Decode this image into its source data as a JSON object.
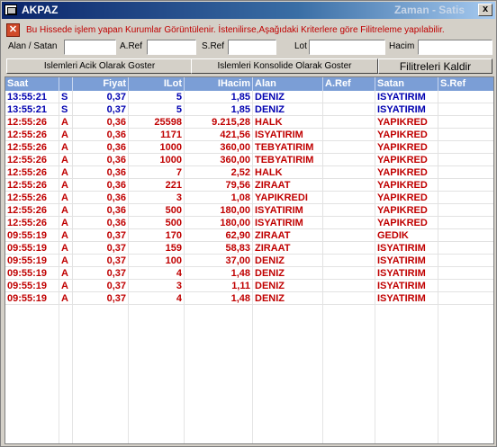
{
  "window": {
    "title": "AKPAZ",
    "title_right": "Zaman - Satis",
    "close_label": "x"
  },
  "info": {
    "text": "Bu Hissede işlem yapan Kurumlar Görüntülenir. İstenilirse,Aşağıdaki Kriterlere göre Filitreleme yapılabilir."
  },
  "filters": {
    "alan_satan_label": "Alan / Satan",
    "aref_label": "A.Ref",
    "sref_label": "S.Ref",
    "lot_label": "Lot",
    "hacim_label": "Hacim",
    "alan_satan_value": "",
    "aref_value": "",
    "sref_value": "",
    "lot_value": "",
    "hacim_value": ""
  },
  "buttons": {
    "acik": "Islemleri Acik Olarak Goster",
    "konsolide": "Islemleri Konsolide Olarak Goster",
    "kaldir": "Filitreleri Kaldir"
  },
  "table": {
    "headers": [
      "Saat",
      "",
      "Fiyat",
      "ILot",
      "IHacim",
      "Alan",
      "A.Ref",
      "Satan",
      "S.Ref"
    ],
    "rows": [
      {
        "saat": "13:55:21",
        "t": "S",
        "fiyat": "0,37",
        "lot": "5",
        "hacim": "1,85",
        "alan": "DENIZ",
        "aref": "",
        "satan": "ISYATIRIM",
        "sref": "",
        "color": "#0000b0"
      },
      {
        "saat": "13:55:21",
        "t": "S",
        "fiyat": "0,37",
        "lot": "5",
        "hacim": "1,85",
        "alan": "DENIZ",
        "aref": "",
        "satan": "ISYATIRIM",
        "sref": "",
        "color": "#0000b0"
      },
      {
        "saat": "12:55:26",
        "t": "A",
        "fiyat": "0,36",
        "lot": "25598",
        "hacim": "9.215,28",
        "alan": "HALK",
        "aref": "",
        "satan": "YAPIKRED",
        "sref": "",
        "color": "#c00000"
      },
      {
        "saat": "12:55:26",
        "t": "A",
        "fiyat": "0,36",
        "lot": "1171",
        "hacim": "421,56",
        "alan": "ISYATIRIM",
        "aref": "",
        "satan": "YAPIKRED",
        "sref": "",
        "color": "#c00000"
      },
      {
        "saat": "12:55:26",
        "t": "A",
        "fiyat": "0,36",
        "lot": "1000",
        "hacim": "360,00",
        "alan": "TEBYATIRIM",
        "aref": "",
        "satan": "YAPIKRED",
        "sref": "",
        "color": "#c00000"
      },
      {
        "saat": "12:55:26",
        "t": "A",
        "fiyat": "0,36",
        "lot": "1000",
        "hacim": "360,00",
        "alan": "TEBYATIRIM",
        "aref": "",
        "satan": "YAPIKRED",
        "sref": "",
        "color": "#c00000"
      },
      {
        "saat": "12:55:26",
        "t": "A",
        "fiyat": "0,36",
        "lot": "7",
        "hacim": "2,52",
        "alan": "HALK",
        "aref": "",
        "satan": "YAPIKRED",
        "sref": "",
        "color": "#c00000"
      },
      {
        "saat": "12:55:26",
        "t": "A",
        "fiyat": "0,36",
        "lot": "221",
        "hacim": "79,56",
        "alan": "ZIRAAT",
        "aref": "",
        "satan": "YAPIKRED",
        "sref": "",
        "color": "#c00000"
      },
      {
        "saat": "12:55:26",
        "t": "A",
        "fiyat": "0,36",
        "lot": "3",
        "hacim": "1,08",
        "alan": "YAPIKREDI",
        "aref": "",
        "satan": "YAPIKRED",
        "sref": "",
        "color": "#c00000"
      },
      {
        "saat": "12:55:26",
        "t": "A",
        "fiyat": "0,36",
        "lot": "500",
        "hacim": "180,00",
        "alan": "ISYATIRIM",
        "aref": "",
        "satan": "YAPIKRED",
        "sref": "",
        "color": "#c00000"
      },
      {
        "saat": "12:55:26",
        "t": "A",
        "fiyat": "0,36",
        "lot": "500",
        "hacim": "180,00",
        "alan": "ISYATIRIM",
        "aref": "",
        "satan": "YAPIKRED",
        "sref": "",
        "color": "#c00000"
      },
      {
        "saat": "09:55:19",
        "t": "A",
        "fiyat": "0,37",
        "lot": "170",
        "hacim": "62,90",
        "alan": "ZIRAAT",
        "aref": "",
        "satan": "GEDIK",
        "sref": "",
        "color": "#c00000"
      },
      {
        "saat": "09:55:19",
        "t": "A",
        "fiyat": "0,37",
        "lot": "159",
        "hacim": "58,83",
        "alan": "ZIRAAT",
        "aref": "",
        "satan": "ISYATIRIM",
        "sref": "",
        "color": "#c00000"
      },
      {
        "saat": "09:55:19",
        "t": "A",
        "fiyat": "0,37",
        "lot": "100",
        "hacim": "37,00",
        "alan": "DENIZ",
        "aref": "",
        "satan": "ISYATIRIM",
        "sref": "",
        "color": "#c00000"
      },
      {
        "saat": "09:55:19",
        "t": "A",
        "fiyat": "0,37",
        "lot": "4",
        "hacim": "1,48",
        "alan": "DENIZ",
        "aref": "",
        "satan": "ISYATIRIM",
        "sref": "",
        "color": "#c00000"
      },
      {
        "saat": "09:55:19",
        "t": "A",
        "fiyat": "0,37",
        "lot": "3",
        "hacim": "1,11",
        "alan": "DENIZ",
        "aref": "",
        "satan": "ISYATIRIM",
        "sref": "",
        "color": "#c00000"
      },
      {
        "saat": "09:55:19",
        "t": "A",
        "fiyat": "0,37",
        "lot": "4",
        "hacim": "1,48",
        "alan": "DENIZ",
        "aref": "",
        "satan": "ISYATIRIM",
        "sref": "",
        "color": "#c00000"
      }
    ]
  },
  "colors": {
    "header_bg": "#7b9ed6",
    "sell": "#0000b0",
    "buy": "#c00000",
    "info_text": "#c00000"
  },
  "icons": {
    "app": "window-icon",
    "warning": "close-x-icon",
    "close": "close-icon"
  }
}
